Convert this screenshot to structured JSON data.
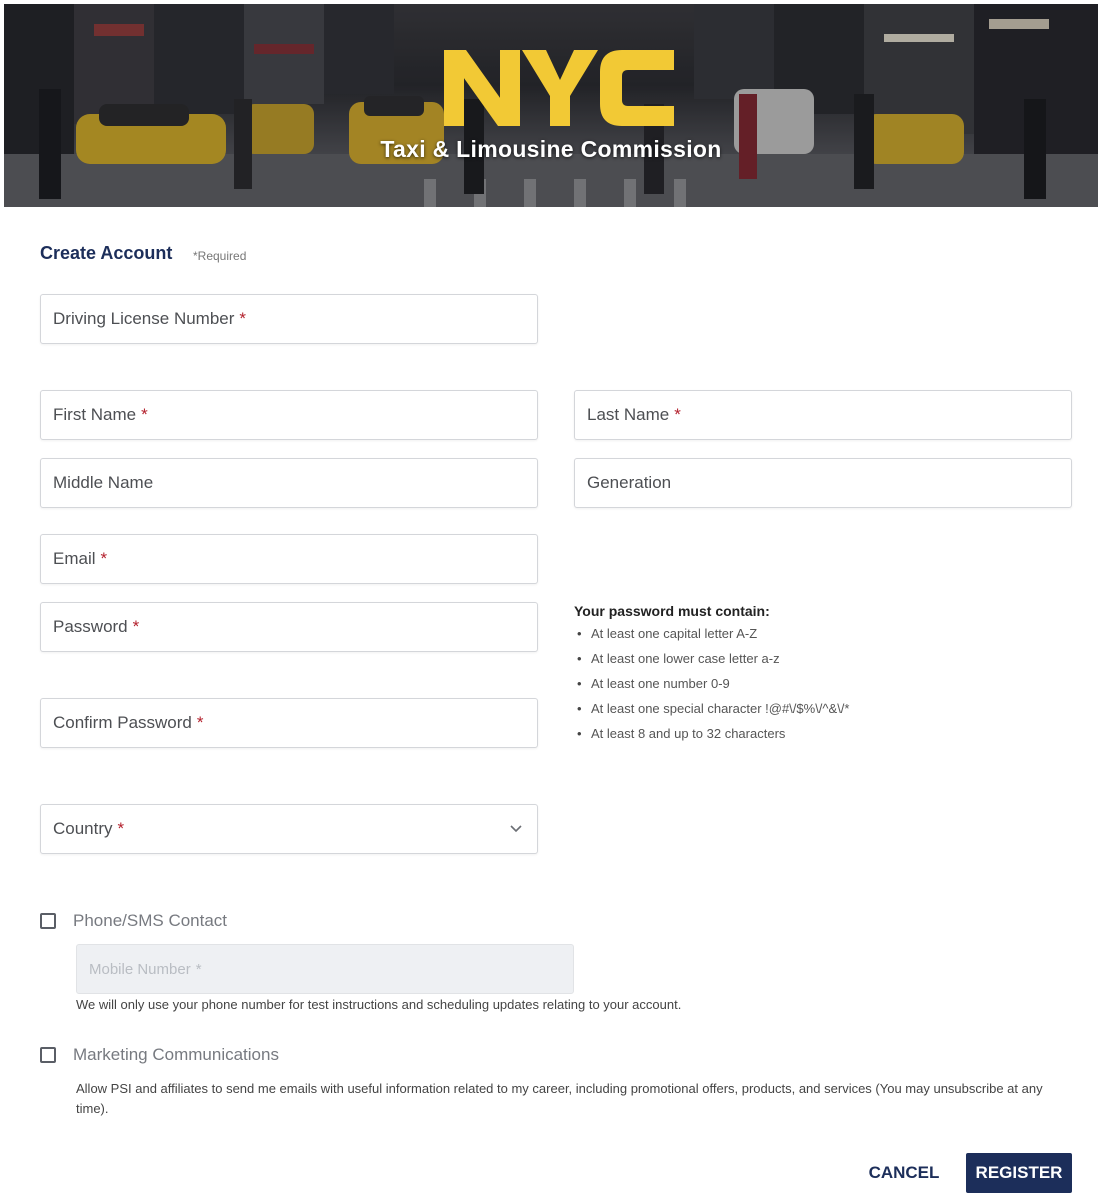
{
  "banner": {
    "logo_text": "NYC",
    "subtitle": "Taxi & Limousine Commission"
  },
  "form": {
    "title": "Create Account",
    "required_note": "*Required",
    "fields": {
      "driving_license": {
        "label": "Driving License Number",
        "required": "*"
      },
      "first_name": {
        "label": "First Name",
        "required": "*"
      },
      "last_name": {
        "label": "Last Name",
        "required": "*"
      },
      "middle_name": {
        "label": "Middle Name"
      },
      "generation": {
        "label": "Generation"
      },
      "email": {
        "label": "Email",
        "required": "*"
      },
      "password": {
        "label": "Password",
        "required": "*"
      },
      "confirm_password": {
        "label": "Confirm Password",
        "required": "*"
      },
      "country": {
        "label": "Country",
        "required": "*"
      },
      "mobile_number": {
        "label": "Mobile Number",
        "required": "*"
      }
    },
    "password_rules": {
      "heading": "Your password must contain:",
      "items": [
        "At least one capital letter A-Z",
        "At least one lower case letter a-z",
        "At least one number 0-9",
        "At least one special character !@#\\/$%\\/^&\\/*",
        "At least 8 and up to 32 characters"
      ]
    },
    "phone_contact": {
      "label": "Phone/SMS Contact",
      "note": "We will only use your phone number for test instructions and scheduling updates relating to your account."
    },
    "marketing": {
      "label": "Marketing Communications",
      "note": "Allow PSI and affiliates to send me emails with useful information related to my career, including promotional offers, products, and services (You may unsubscribe at any time)."
    },
    "buttons": {
      "cancel": "CANCEL",
      "register": "REGISTER"
    }
  },
  "colors": {
    "brand_navy": "#1c2e5a",
    "logo_yellow": "#f2c935",
    "required_red": "#b3202c"
  }
}
